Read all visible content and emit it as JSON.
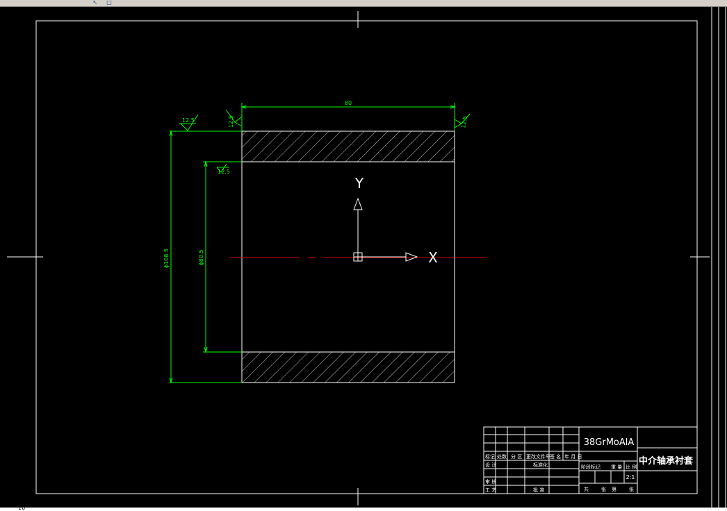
{
  "toolbar": {
    "tools": [
      "arrow-tool-icon",
      "zoom-tool-icon"
    ]
  },
  "drawing": {
    "dims": {
      "length": "80",
      "outer_dia": "ϕ108.5",
      "inner_dia": "ϕ80.5",
      "rough_left": "12.5",
      "rough_top": "12.5",
      "rough_right": "12.5",
      "rough_inner": "12.5"
    },
    "ucs": {
      "x": "X",
      "y": "Y"
    }
  },
  "title_block": {
    "material": "38GrMoAlA",
    "part_name": "中介轴承衬套",
    "scale": "2:1",
    "labels": {
      "mark": "标记",
      "count": "处数",
      "zone": "分 区",
      "change_doc": "更改文件号",
      "sign": "签 名",
      "date": "年 月 日",
      "design": "设 计",
      "standardize": "标准化",
      "stage_mark": "阶段标记",
      "weight": "重 量",
      "ratio": "比 例",
      "review": "审 核",
      "process": "工 艺",
      "approve": "批 准",
      "total": "共",
      "sheets": "张",
      "no": "第",
      "sheet": "张"
    }
  },
  "status": {
    "coord_hint": "10"
  },
  "colors": {
    "bg": "#000000",
    "line": "#ffffff",
    "dim": "#00ff00",
    "axis": "#cc0000"
  }
}
